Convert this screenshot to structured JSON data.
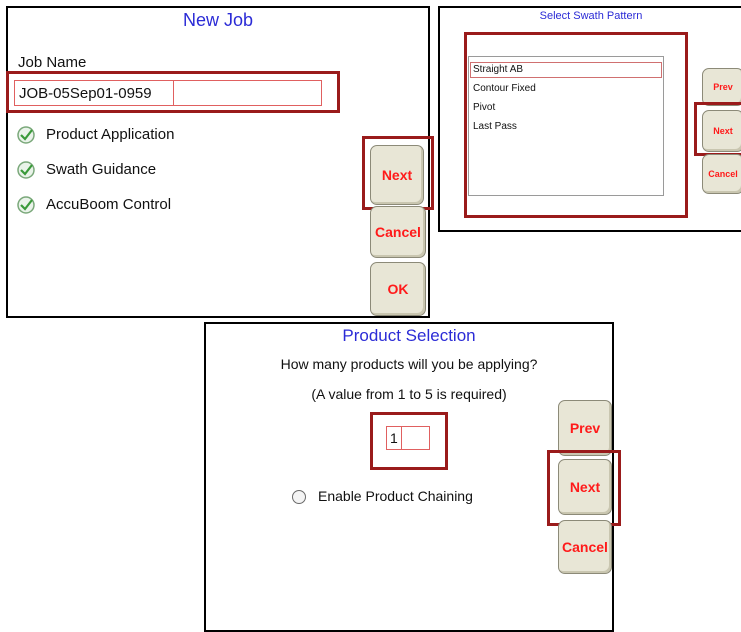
{
  "new_job": {
    "title": "New Job",
    "job_name_label": "Job Name",
    "job_name_value": "JOB-05Sep01-0959",
    "options": [
      {
        "label": "Product Application",
        "icon": "check-circle-icon"
      },
      {
        "label": "Swath Guidance",
        "icon": "check-circle-icon"
      },
      {
        "label": "AccuBoom Control",
        "icon": "check-circle-icon"
      }
    ],
    "next_label": "Next",
    "cancel_label": "Cancel",
    "ok_label": "OK"
  },
  "swath": {
    "title": "Select Swath Pattern",
    "items": [
      "Straight AB",
      "Contour Fixed",
      "Pivot",
      "Last Pass"
    ],
    "selected": "Straight AB",
    "prev_label": "Prev",
    "next_label": "Next",
    "cancel_label": "Cancel"
  },
  "product": {
    "title": "Product Selection",
    "question": "How many products will you be applying?",
    "hint": "(A value from 1 to 5 is required)",
    "count_value": "1",
    "chaining_label": "Enable Product Chaining",
    "prev_label": "Prev",
    "next_label": "Next",
    "cancel_label": "Cancel"
  },
  "colors": {
    "title_blue": "#2b2bd6",
    "button_red": "#ff1a1a",
    "highlight_red": "#9a1b1b",
    "check_green": "#3a9a3a"
  }
}
